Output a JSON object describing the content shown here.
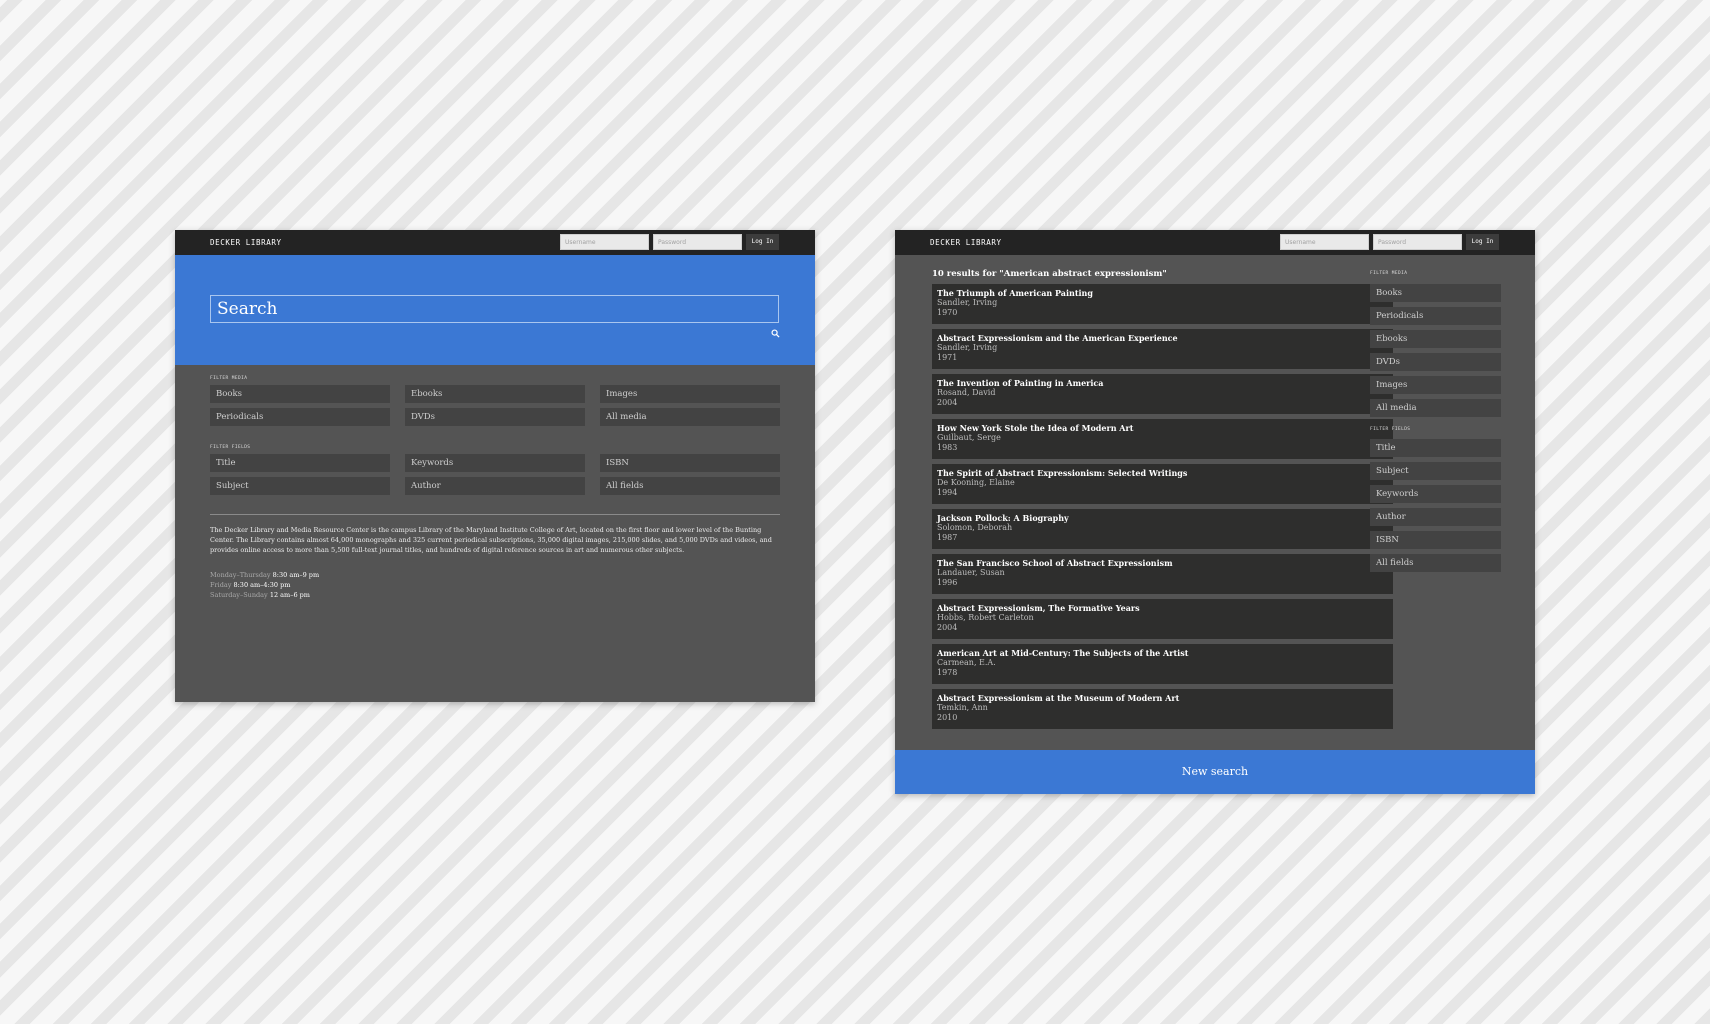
{
  "brand": "DECKER LIBRARY",
  "login": {
    "username_placeholder": "Username",
    "password_placeholder": "Password",
    "button_label": "Log In"
  },
  "search": {
    "placeholder": "Search"
  },
  "filter_media": {
    "label": "FILTER MEDIA",
    "home_items": [
      "Books",
      "Ebooks",
      "Images",
      "Periodicals",
      "DVDs",
      "All media"
    ],
    "side_items": [
      "Books",
      "Periodicals",
      "Ebooks",
      "DVDs",
      "Images",
      "All media"
    ]
  },
  "filter_fields": {
    "label": "FILTER FIELDS",
    "home_items": [
      "Title",
      "Keywords",
      "ISBN",
      "Subject",
      "Author",
      "All fields"
    ],
    "side_items": [
      "Title",
      "Subject",
      "Keywords",
      "Author",
      "ISBN",
      "All fields"
    ]
  },
  "about": "The Decker Library and Media Resource Center is the campus Library of the Maryland Institute College of Art, located on the first floor and lower level of the Bunting Center. The Library contains almost 64,000 monographs and 325 current periodical subscriptions, 35,000 digital images, 215,000 slides, and 5,000 DVDs and videos, and provides online access to more than 5,500 full-text journal titles, and hundreds of digital reference sources in art and numerous other subjects.",
  "hours": [
    {
      "days": "Monday–Thursday",
      "time": "8:30 am–9 pm"
    },
    {
      "days": "Friday",
      "time": "8:30 am–4:30 pm"
    },
    {
      "days": "Saturday–Sunday",
      "time": "12 am–6 pm"
    }
  ],
  "results_heading": "10 results for \"American abstract expressionism\"",
  "results": [
    {
      "title": "The Triumph of American Painting",
      "author": "Sandler, Irving",
      "year": "1970"
    },
    {
      "title": "Abstract Expressionism and the American Experience",
      "author": "Sandler, Irving",
      "year": "1971"
    },
    {
      "title": "The Invention of Painting in America",
      "author": "Rosand, David",
      "year": "2004"
    },
    {
      "title": "How New York Stole the Idea of Modern Art",
      "author": "Guilbaut, Serge",
      "year": "1983"
    },
    {
      "title": "The Spirit of Abstract Expressionism: Selected Writings",
      "author": "De Kooning, Elaine",
      "year": "1994"
    },
    {
      "title": "Jackson Pollock: A Biography",
      "author": "Solomon, Deborah",
      "year": "1987"
    },
    {
      "title": "The San Francisco School of Abstract Expressionism",
      "author": "Landauer, Susan",
      "year": "1996"
    },
    {
      "title": "Abstract Expressionism, The Formative Years",
      "author": "Hobbs, Robert Carleton",
      "year": "2004"
    },
    {
      "title": "American Art at Mid-Century: The Subjects of the Artist",
      "author": "Carmean, E.A.",
      "year": "1978"
    },
    {
      "title": "Abstract Expressionism at the Museum of Modern Art",
      "author": "Temkin, Ann",
      "year": "2010"
    }
  ],
  "new_search_label": "New search",
  "colors": {
    "accent_blue": "#3b78d4",
    "topbar": "#232323",
    "panel": "#545454",
    "chip": "#434343",
    "result_card": "#2e2e2d"
  }
}
